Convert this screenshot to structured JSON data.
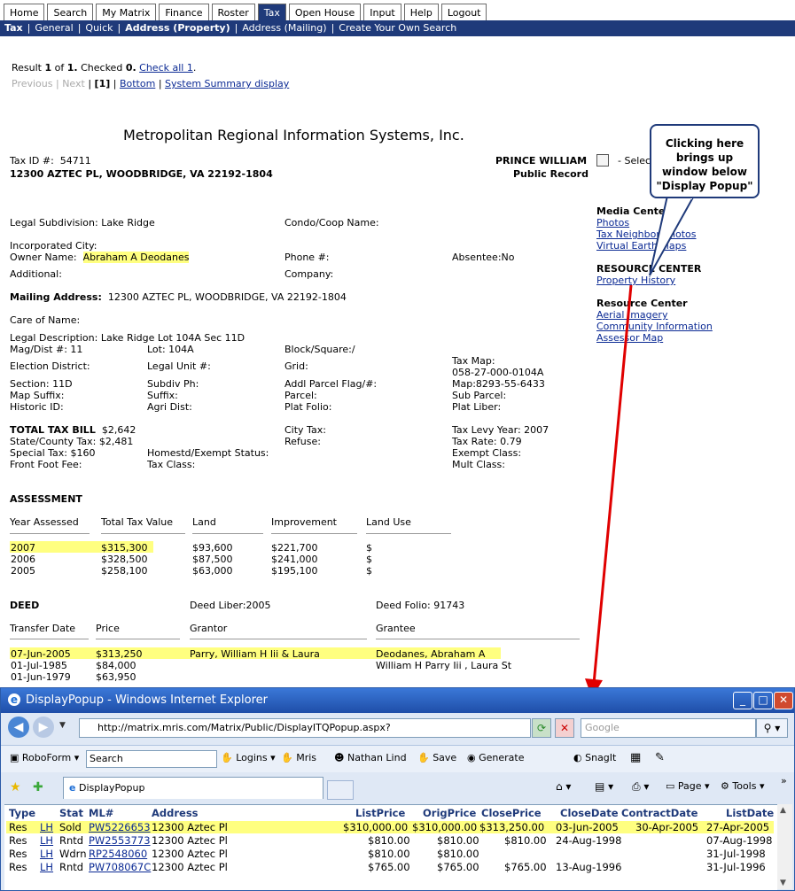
{
  "nav": {
    "tabs": [
      "Home",
      "Search",
      "My Matrix",
      "Finance",
      "Roster",
      "Tax",
      "Open House",
      "Input",
      "Help",
      "Logout"
    ],
    "active_tab": "Tax",
    "sub": [
      "Tax",
      "General",
      "Quick",
      "Address (Property)",
      "Address (Mailing)",
      "Create Your Own Search"
    ]
  },
  "results": {
    "result_prefix": "Result",
    "result_num": "1",
    "of": "of",
    "total": "1.",
    "checked_label": "Checked",
    "checked_num": "0.",
    "check_all": "Check all 1",
    "previous": "Previous",
    "next": "Next",
    "page": "[1]",
    "bottom": "Bottom",
    "summary": "System Summary display"
  },
  "report": {
    "company": "Metropolitan Regional Information Systems, Inc.",
    "tax_id_label": "Tax ID #:",
    "tax_id": "54711",
    "address": "12300 AZTEC PL, WOODBRIDGE, VA   22192-1804",
    "county": "PRINCE WILLIAM",
    "record_type": "Public Record",
    "select_label": "- Selec",
    "legal_subdivision": "Legal Subdivision:  Lake Ridge",
    "condo": "Condo/Coop Name:",
    "incorporated_city": "Incorporated City:",
    "owner_label": "Owner Name:",
    "owner": "Abraham A Deodanes",
    "phone": "Phone #:",
    "absentee": "Absentee:No",
    "additional": "Additional:",
    "company_label": "Company:",
    "mailing_label": "Mailing Address:",
    "mailing": "12300 AZTEC PL, WOODBRIDGE,  VA  22192-1804",
    "care_of": "Care of Name:",
    "legal_desc": "Legal Description:  Lake Ridge Lot 104A Sec 11D",
    "mag_dist": "Mag/Dist #:  11",
    "lot": "Lot:  104A",
    "block": "Block/Square:/",
    "election": "Election District:",
    "legal_unit": "Legal Unit #:",
    "grid": "Grid:",
    "tax_map_label": "Tax Map:",
    "tax_map": "058-27-000-0104A",
    "section": "Section:  11D",
    "subdiv_ph": "Subdiv Ph:",
    "addl_parcel": "Addl Parcel Flag/#:",
    "map": "Map:8293-55-6433",
    "map_suffix": "Map Suffix:",
    "suffix": "Suffix:",
    "parcel": "Parcel:",
    "sub_parcel": "Sub Parcel:",
    "historic": "Historic ID:",
    "agri": "Agri Dist:",
    "plat_folio": "Plat Folio:",
    "plat_liber": "Plat Liber:",
    "total_tax_label": "TOTAL TAX BILL",
    "total_tax": "$2,642",
    "city_tax": "City Tax:",
    "levy_year": "Tax Levy Year:  2007",
    "state_tax": "State/County Tax:  $2,481",
    "refuse": "Refuse:",
    "tax_rate": "Tax Rate:  0.79",
    "special_tax": "Special Tax:  $160",
    "homestd": "Homestd/Exempt Status:",
    "exempt": "Exempt Class:",
    "front_foot": "Front Foot Fee:",
    "tax_class": "Tax Class:",
    "mult_class": "Mult Class:",
    "assessment_title": "ASSESSMENT",
    "assessment_headers": [
      "Year Assessed",
      "Total Tax Value",
      "Land",
      "Improvement",
      "Land Use"
    ],
    "assessment_rows": [
      [
        "2007",
        "$315,300",
        "$93,600",
        "$221,700",
        "$"
      ],
      [
        "2006",
        "$328,500",
        "$87,500",
        "$241,000",
        "$"
      ],
      [
        "2005",
        "$258,100",
        "$63,000",
        "$195,100",
        "$"
      ]
    ],
    "deed_title": "DEED",
    "deed_liber": "Deed Liber:2005",
    "deed_folio": "Deed Folio:  91743",
    "deed_headers": [
      "Transfer Date",
      "Price",
      "Grantor",
      "Grantee"
    ],
    "deed_rows": [
      [
        "07-Jun-2005",
        "$313,250",
        "Parry, William H Iii & Laura",
        "Deodanes, Abraham A"
      ],
      [
        "01-Jul-1985",
        "$84,000",
        "",
        "William H Parry Iii , Laura St"
      ],
      [
        "01-Jun-1979",
        "$63,950",
        "",
        ""
      ]
    ]
  },
  "sidebar": {
    "media_title": "Media Center",
    "media_links": [
      "Photos",
      "Tax Neighbor Photos",
      "Virtual Earth Maps"
    ],
    "resource_title": "RESOURCE CENTER",
    "resource_links": [
      "Property History"
    ],
    "resource2_title": "Resource Center",
    "resource2_links": [
      "Aerial Imagery",
      "Community Information",
      "Assessor Map"
    ]
  },
  "callout": {
    "text": "Clicking here brings up window below \"Display Popup\""
  },
  "popup": {
    "title": "DisplayPopup - Windows Internet Explorer",
    "url": "http://matrix.mris.com/Matrix/Public/DisplayITQPopup.aspx?iid=85&did=101259&params=3218",
    "search_placeholder": "Google",
    "toolbar": {
      "roboform": "RoboForm",
      "search": "Search",
      "logins": "Logins",
      "mris": "Mris",
      "user": "Nathan Lind",
      "save": "Save",
      "generate": "Generate",
      "snagit": "SnagIt"
    },
    "tab_label": "DisplayPopup",
    "cmd": {
      "page": "Page",
      "tools": "Tools"
    },
    "headers": [
      "Type",
      "Stat",
      "ML#",
      "Address",
      "ListPrice",
      "OrigPrice",
      "ClosePrice",
      "CloseDate",
      "ContractDate",
      "ListDate"
    ],
    "rows": [
      [
        "Res",
        "LH",
        "Sold",
        "PW5226653",
        "12300 Aztec Pl",
        "$310,000.00",
        "$310,000.00",
        "$313,250.00",
        "03-Jun-2005",
        "30-Apr-2005",
        "27-Apr-2005"
      ],
      [
        "Res",
        "LH",
        "Rntd",
        "PW2553773",
        "12300 Aztec Pl",
        "$810.00",
        "$810.00",
        "$810.00",
        "24-Aug-1998",
        "",
        "07-Aug-1998"
      ],
      [
        "Res",
        "LH",
        "Wdrn",
        "RP2548060",
        "12300 Aztec Pl",
        "$810.00",
        "$810.00",
        "",
        "",
        "",
        "31-Jul-1998"
      ],
      [
        "Res",
        "LH",
        "Rntd",
        "PW708067C",
        "12300 Aztec Pl",
        "$765.00",
        "$765.00",
        "$765.00",
        "13-Aug-1996",
        "",
        "31-Jul-1996"
      ]
    ]
  },
  "colors": {
    "nav_blue": "#1f3a7a",
    "highlight": "#ffff80",
    "arrow_red": "#e00000"
  }
}
